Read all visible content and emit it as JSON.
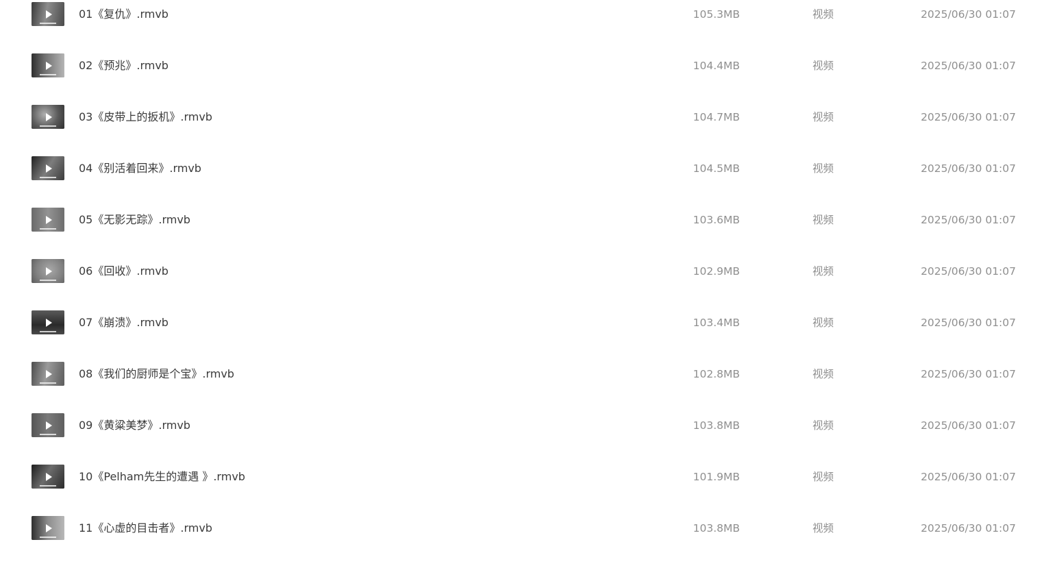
{
  "files": [
    {
      "name": "01《复仇》.rmvb",
      "size": "105.3MB",
      "type": "视频",
      "modified": "2025/06/30 01:07"
    },
    {
      "name": "02《预兆》.rmvb",
      "size": "104.4MB",
      "type": "视频",
      "modified": "2025/06/30 01:07"
    },
    {
      "name": "03《皮带上的扳机》.rmvb",
      "size": "104.7MB",
      "type": "视频",
      "modified": "2025/06/30 01:07"
    },
    {
      "name": "04《别活着回来》.rmvb",
      "size": "104.5MB",
      "type": "视频",
      "modified": "2025/06/30 01:07"
    },
    {
      "name": "05《无影无踪》.rmvb",
      "size": "103.6MB",
      "type": "视频",
      "modified": "2025/06/30 01:07"
    },
    {
      "name": "06《回收》.rmvb",
      "size": "102.9MB",
      "type": "视频",
      "modified": "2025/06/30 01:07"
    },
    {
      "name": "07《崩溃》.rmvb",
      "size": "103.4MB",
      "type": "视频",
      "modified": "2025/06/30 01:07"
    },
    {
      "name": "08《我们的厨师是个宝》.rmvb",
      "size": "102.8MB",
      "type": "视频",
      "modified": "2025/06/30 01:07"
    },
    {
      "name": "09《黄粱美梦》.rmvb",
      "size": "103.8MB",
      "type": "视频",
      "modified": "2025/06/30 01:07"
    },
    {
      "name": "10《Pelham先生的遭遇 》.rmvb",
      "size": "101.9MB",
      "type": "视频",
      "modified": "2025/06/30 01:07"
    },
    {
      "name": "11《心虚的目击者》.rmvb",
      "size": "103.8MB",
      "type": "视频",
      "modified": "2025/06/30 01:07"
    }
  ],
  "icons": {
    "thumbnail": "video-thumbnail-icon",
    "play": "play-icon"
  },
  "colors": {
    "name_text": "#3b3b3b",
    "meta_text": "#8f8f8f",
    "background": "#ffffff"
  }
}
